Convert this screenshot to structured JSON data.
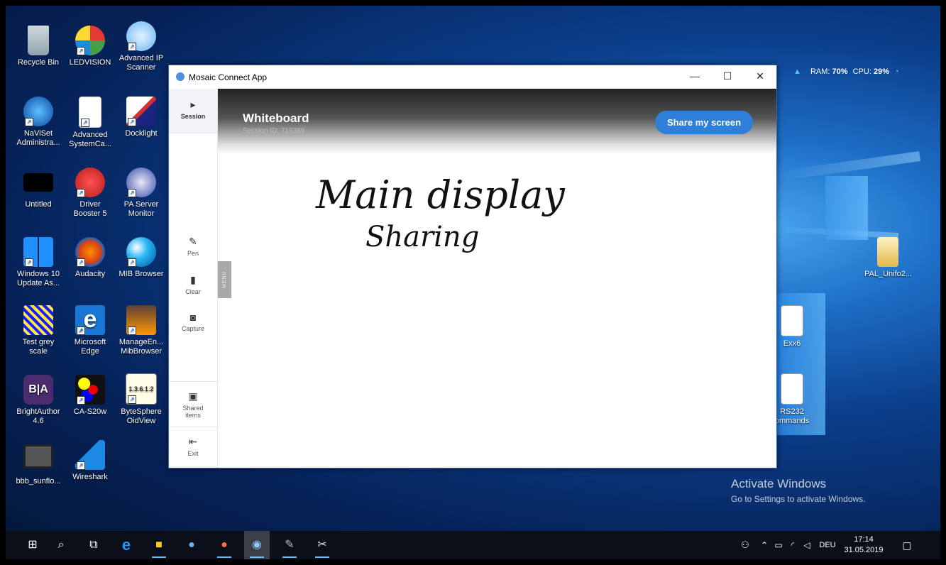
{
  "desktop": {
    "icons": [
      {
        "label": "Recycle Bin"
      },
      {
        "label": "LEDVISION"
      },
      {
        "label": "Advanced IP Scanner"
      },
      {
        "label": "NaViSet Administra..."
      },
      {
        "label": "Advanced SystemCa..."
      },
      {
        "label": "Docklight"
      },
      {
        "label": "Untitled"
      },
      {
        "label": "Driver Booster 5"
      },
      {
        "label": "PA Server Monitor"
      },
      {
        "label": "Windows 10 Update As..."
      },
      {
        "label": "Audacity"
      },
      {
        "label": "MIB Browser"
      },
      {
        "label": "Test grey scale"
      },
      {
        "label": "Microsoft Edge"
      },
      {
        "label": "ManageEn... MibBrowser"
      },
      {
        "label": "BrightAuthor 4.6"
      },
      {
        "label": "CA-S20w"
      },
      {
        "label": "ByteSphere OidView"
      },
      {
        "label": "bbb_sunflo..."
      },
      {
        "label": "Wireshark"
      },
      {
        "label": "PAL_Unifo2..."
      },
      {
        "label": "Exx6"
      },
      {
        "label": "RS232 ommands"
      }
    ],
    "activate": {
      "title": "Activate Windows",
      "subtitle": "Go to Settings to activate Windows."
    },
    "sysmon": {
      "ram_label": "RAM:",
      "ram_value": "70",
      "cpu_label": "CPU:",
      "cpu_value": "29",
      "unit": "%"
    }
  },
  "window": {
    "title": "Mosaic Connect App",
    "minimize": "—",
    "maximize": "☐",
    "close": "✕",
    "sidebar": {
      "session": "Session",
      "pen": "Pen",
      "clear": "Clear",
      "capture": "Capture",
      "shared": "Shared items",
      "exit": "Exit"
    },
    "menu_tab": "MENU",
    "header": {
      "title": "Whiteboard",
      "session_id": "Session ID: 719389",
      "share_button": "Share my screen"
    },
    "drawing": {
      "line1": "Main display",
      "line2": "Sharing"
    }
  },
  "taskbar": {
    "clock_time": "17:14",
    "clock_date": "31.05.2019",
    "lang": "DEU"
  }
}
